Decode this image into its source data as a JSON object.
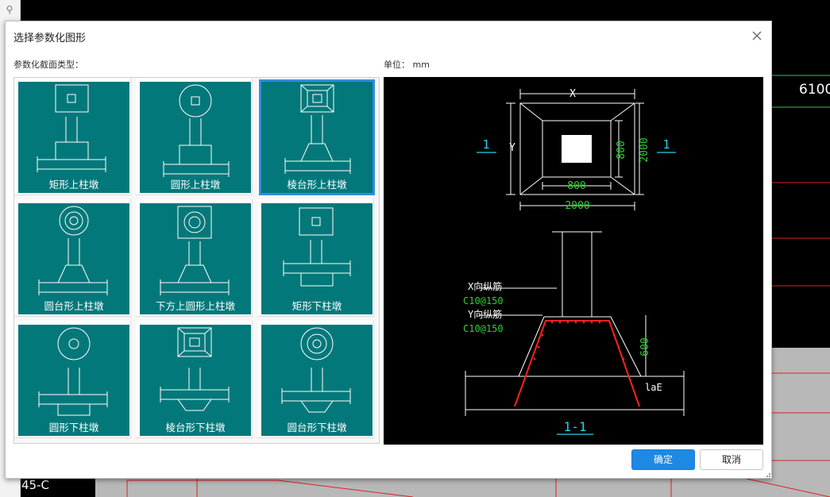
{
  "dialog": {
    "title": "选择参数化图形",
    "section_label": "参数化截面类型：",
    "unit_label": "单位：  mm",
    "ok_label": "确定",
    "cancel_label": "取消"
  },
  "tiles": [
    {
      "label": "矩形上柱墩",
      "selected": false
    },
    {
      "label": "圆形上柱墩",
      "selected": false
    },
    {
      "label": "棱台形上柱墩",
      "selected": true
    },
    {
      "label": "圆台形上柱墩",
      "selected": false
    },
    {
      "label": "下方上圆形上柱墩",
      "selected": false
    },
    {
      "label": "矩形下柱墩",
      "selected": false
    },
    {
      "label": "圆形下柱墩",
      "selected": false
    },
    {
      "label": "棱台形下柱墩",
      "selected": false
    },
    {
      "label": "圆台形下柱墩",
      "selected": false
    }
  ],
  "preview": {
    "plan_x": "X",
    "plan_y": "Y",
    "dim_inner_w": "800",
    "dim_inner_h": "800",
    "dim_outer_w": "2000",
    "dim_outer_h": "2000",
    "section_mark": "1",
    "section_title": "1-1",
    "x_rebar": "X向纵筋",
    "x_rebar_spec": "C10@150",
    "y_rebar": "Y向纵筋",
    "y_rebar_spec": "C10@150",
    "dim_height": "600",
    "lae": "laE"
  },
  "background": {
    "number": "6100",
    "axis": "45-C"
  },
  "colors": {
    "teal": "#03787a",
    "accent": "#1e88e5",
    "dim_green": "#33cc33",
    "mark_cyan": "#22d3ee",
    "rebar_red": "#ff2020"
  }
}
